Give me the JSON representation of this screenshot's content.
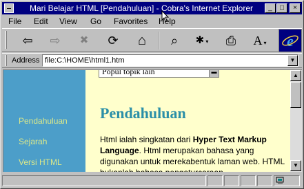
{
  "window": {
    "title": "Mari Belajar HTML [Pendahuluan] - Cobra's Internet Explorer",
    "min_glyph": "_",
    "max_glyph": "□",
    "close_glyph": "×"
  },
  "menu": [
    "File",
    "Edit",
    "View",
    "Go",
    "Favorites",
    "Help"
  ],
  "toolbar": {
    "buttons": [
      {
        "name": "back-icon",
        "glyph": "⇦"
      },
      {
        "name": "forward-icon",
        "glyph": "⇨"
      },
      {
        "name": "stop-icon",
        "glyph": "✖"
      },
      {
        "name": "refresh-icon",
        "glyph": "⟳"
      },
      {
        "name": "home-icon",
        "glyph": "⌂"
      },
      {
        "name": "search-icon",
        "glyph": "⌕"
      },
      {
        "name": "favorites-icon",
        "glyph": "✱"
      },
      {
        "name": "print-icon",
        "glyph": "⎙"
      },
      {
        "name": "font-icon",
        "glyph": "A"
      }
    ]
  },
  "address": {
    "label": "Address",
    "value": "file:C:\\HOME\\html1.htm"
  },
  "sidebar": {
    "links": [
      "Pendahuluan",
      "Sejarah",
      "Versi HTML"
    ]
  },
  "content": {
    "select_text": "Popul topik lain",
    "heading": "Pendahuluan",
    "para_intro": "Html ialah singkatan dari ",
    "para_bold": "Hyper Text Markup Language",
    "para_rest": ". Html merupakan bahasa yang digunakan untuk merekabentuk laman web. HTML bukanlah bahasa pengaturcaraan"
  },
  "colors": {
    "titlebar": "#000080",
    "sidebar": "#4c9ec9",
    "sidebar_link": "#dbe88a",
    "content_bg": "#ffffcc",
    "heading": "#2a8fa8"
  }
}
